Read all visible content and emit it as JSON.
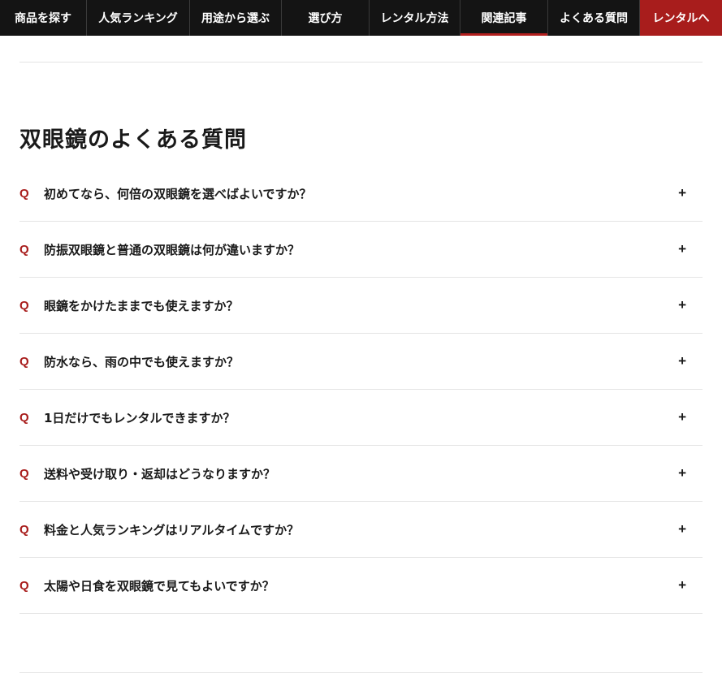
{
  "nav": {
    "items": [
      {
        "label": "商品を探す"
      },
      {
        "label": "人気ランキング"
      },
      {
        "label": "用途から選ぶ"
      },
      {
        "label": "選び方"
      },
      {
        "label": "レンタル方法"
      },
      {
        "label": "関連記事"
      },
      {
        "label": "よくある質問"
      },
      {
        "label": "レンタルへ"
      }
    ],
    "active_index": 5,
    "accent_color": "#a81d1c"
  },
  "faq": {
    "title": "双眼鏡のよくある質問",
    "q_marker": "Q",
    "expand_symbol": "+",
    "items": [
      {
        "question": "初めてなら、何倍の双眼鏡を選べばよいですか？"
      },
      {
        "question": "防振双眼鏡と普通の双眼鏡は何が違いますか？"
      },
      {
        "question": "眼鏡をかけたままでも使えますか？"
      },
      {
        "question": "防水なら、雨の中でも使えますか？"
      },
      {
        "question": "1日だけでもレンタルできますか？"
      },
      {
        "question": "送料や受け取り・返却はどうなりますか？"
      },
      {
        "question": "料金と人気ランキングはリアルタイムですか？"
      },
      {
        "question": "太陽や日食を双眼鏡で見てもよいですか？"
      }
    ]
  }
}
